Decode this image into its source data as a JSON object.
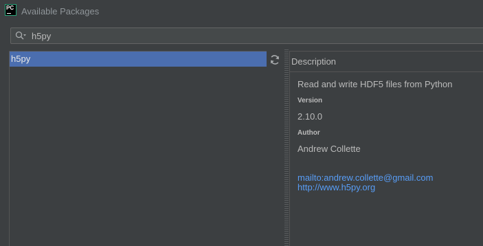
{
  "window": {
    "title": "Available Packages",
    "app_icon_text": "PC"
  },
  "search": {
    "value": "h5py"
  },
  "packages": {
    "items": [
      {
        "label": "h5py",
        "selected": true
      }
    ]
  },
  "details": {
    "header": "Description",
    "summary": "Read and write HDF5 files from Python",
    "version_label": "Version",
    "version": "2.10.0",
    "author_label": "Author",
    "author": "Andrew Collette",
    "email_link": "mailto:andrew.collette@gmail.com",
    "homepage_link": "http://www.h5py.org"
  },
  "colors": {
    "background": "#3c3f41",
    "selection": "#4b6eaf",
    "link": "#589df6",
    "text": "#bbbbbb"
  }
}
